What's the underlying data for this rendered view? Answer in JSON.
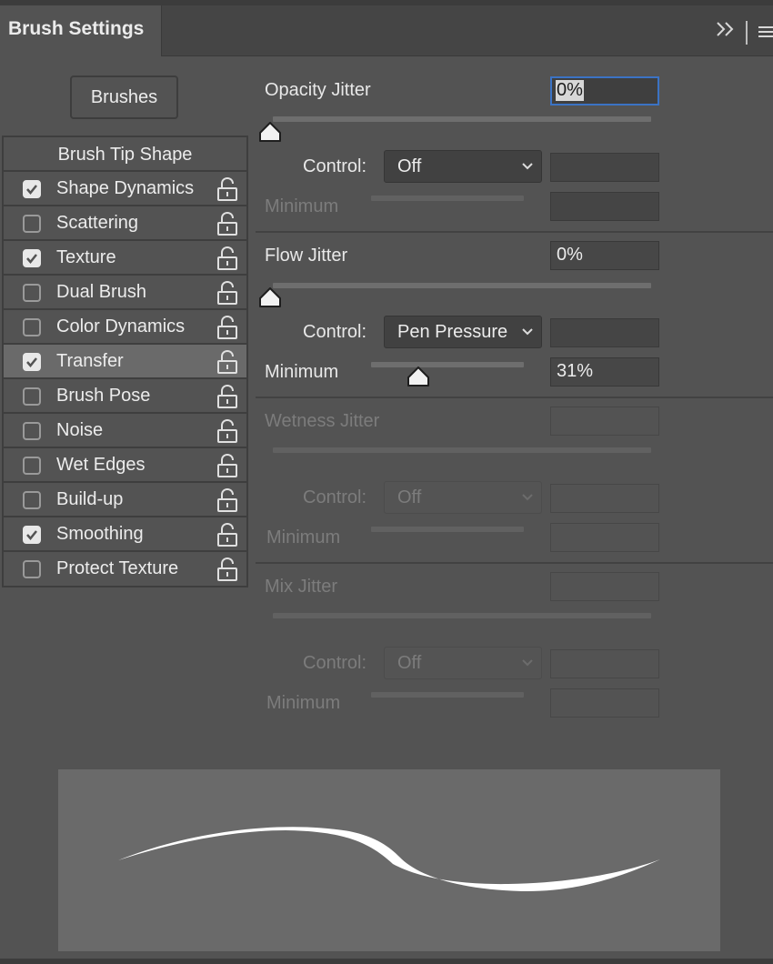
{
  "panel": {
    "title": "Brush Settings",
    "brushes_button": "Brushes"
  },
  "options": {
    "header": "Brush Tip Shape",
    "items": [
      {
        "label": "Shape Dynamics",
        "checked": true,
        "selected": false
      },
      {
        "label": "Scattering",
        "checked": false,
        "selected": false
      },
      {
        "label": "Texture",
        "checked": true,
        "selected": false
      },
      {
        "label": "Dual Brush",
        "checked": false,
        "selected": false
      },
      {
        "label": "Color Dynamics",
        "checked": false,
        "selected": false
      },
      {
        "label": "Transfer",
        "checked": true,
        "selected": true
      },
      {
        "label": "Brush Pose",
        "checked": false,
        "selected": false
      },
      {
        "label": "Noise",
        "checked": false,
        "selected": false
      },
      {
        "label": "Wet Edges",
        "checked": false,
        "selected": false
      },
      {
        "label": "Build-up",
        "checked": false,
        "selected": false
      },
      {
        "label": "Smoothing",
        "checked": true,
        "selected": false
      },
      {
        "label": "Protect Texture",
        "checked": false,
        "selected": false
      }
    ]
  },
  "transfer": {
    "opacity_jitter": {
      "label": "Opacity Jitter",
      "value": "0%",
      "slider_fraction": 0.0,
      "control_label": "Control:",
      "control_value": "Off",
      "minimum_label": "Minimum"
    },
    "flow_jitter": {
      "label": "Flow Jitter",
      "value": "0%",
      "slider_fraction": 0.0,
      "control_label": "Control:",
      "control_value": "Pen Pressure",
      "minimum_label": "Minimum",
      "minimum_value": "31%",
      "minimum_fraction": 0.31
    },
    "wetness_jitter": {
      "label": "Wetness Jitter",
      "control_label": "Control:",
      "control_value": "Off",
      "minimum_label": "Minimum"
    },
    "mix_jitter": {
      "label": "Mix Jitter",
      "control_label": "Control:",
      "control_value": "Off",
      "minimum_label": "Minimum"
    }
  },
  "colors": {
    "panel_bg": "#535353",
    "selected_row": "#6a6a6a",
    "focus_border": "#3b73c4",
    "preview_bg": "#6a6a6a"
  }
}
